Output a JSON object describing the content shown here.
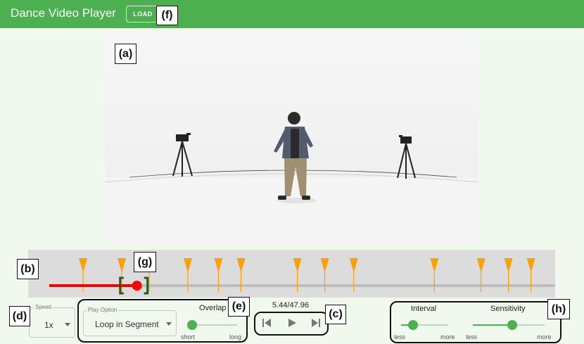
{
  "app": {
    "title": "Dance Video Player",
    "load_label": "LOAD"
  },
  "callouts": {
    "a": "(a)",
    "b": "(b)",
    "c": "(c)",
    "d": "(d)",
    "e": "(e)",
    "f": "(f)",
    "g": "(g)",
    "h": "(h)"
  },
  "timeline": {
    "duration_seconds": 47.96,
    "current_seconds": 5.44,
    "segment_start_seconds": 4.4,
    "segment_end_seconds": 6.1,
    "marker_seconds": [
      2.1,
      4.5,
      6.2,
      8.6,
      10.5,
      11.9,
      15.4,
      17.1,
      18.9,
      23.9,
      26.8,
      28.5,
      29.9
    ],
    "colors": {
      "progress": "#ff0000",
      "marker": "#ffa000",
      "segment_bracket": "#1b5e20",
      "track": "#bdbdbd"
    }
  },
  "controls": {
    "speed": {
      "label": "Speed",
      "value": "1x"
    },
    "play_option": {
      "label": "Play Option",
      "value": "Loop in Segment"
    },
    "overlap": {
      "label": "Overlap",
      "min_label": "short",
      "max_label": "long",
      "value_fraction": 0.0
    },
    "time_readout": "5.44/47.96",
    "transport_icons": [
      "skip-previous-icon",
      "play-icon",
      "skip-next-icon"
    ],
    "interval": {
      "label": "Interval",
      "min_label": "less",
      "max_label": "more",
      "value_fraction": 0.25
    },
    "sensitivity": {
      "label": "Sensitivity",
      "min_label": "less",
      "max_label": "more",
      "value_fraction": 0.55
    }
  },
  "colors": {
    "accent": "#4caf50",
    "app_bar": "#4caf50",
    "background": "#f1f8ee"
  }
}
